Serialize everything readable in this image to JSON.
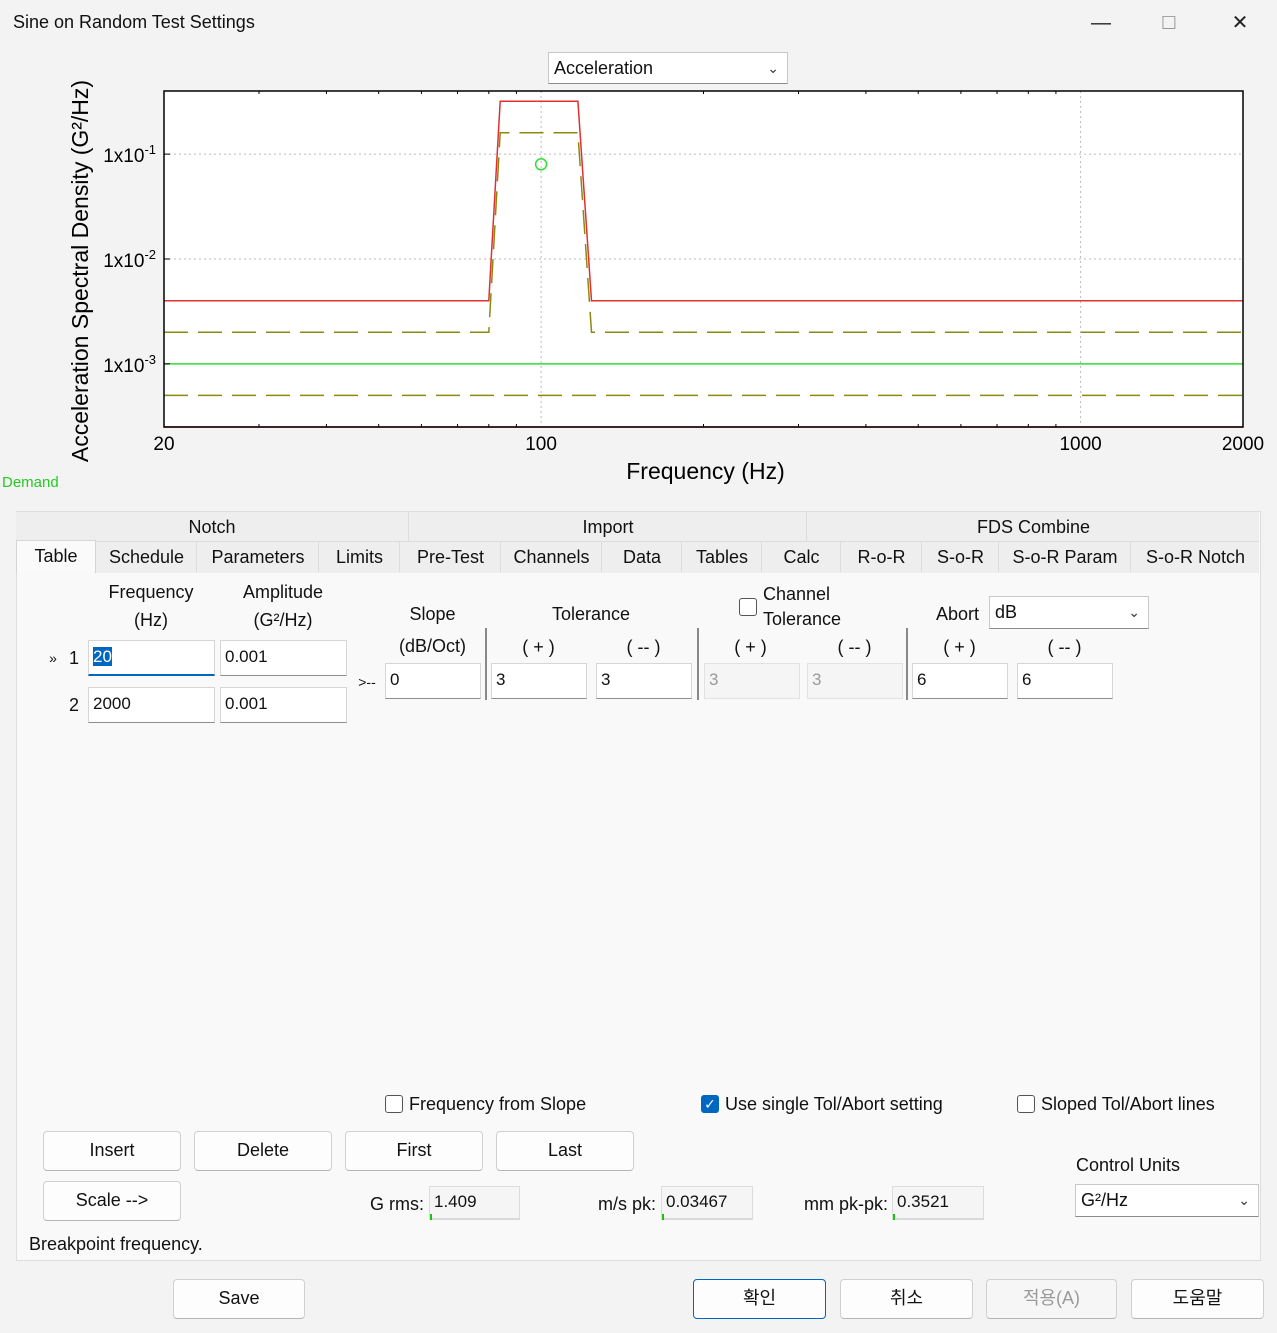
{
  "window": {
    "title": "Sine on Random Test Settings",
    "minimize_glyph": "—",
    "maximize_glyph": "☐",
    "close_glyph": "✕"
  },
  "top_combo": {
    "value": "Acceleration"
  },
  "chart_data": {
    "type": "line",
    "xscale": "log",
    "yscale": "log",
    "xlabel": "Frequency (Hz)",
    "ylabel": "Acceleration Spectral Density (G²/Hz)",
    "xlim": [
      20,
      2000
    ],
    "ylim": [
      0.00025,
      0.4
    ],
    "xticks": [
      {
        "value": 20,
        "label": "20"
      },
      {
        "value": 100,
        "label": "100"
      },
      {
        "value": 1000,
        "label": "1000"
      },
      {
        "value": 2000,
        "label": "2000"
      }
    ],
    "yticks": [
      {
        "value": 0.1,
        "base": "1x10",
        "exp": "-1"
      },
      {
        "value": 0.01,
        "base": "1x10",
        "exp": "-2"
      },
      {
        "value": 0.001,
        "base": "1x10",
        "exp": "-3"
      }
    ],
    "grid": true,
    "series": [
      {
        "role": "demand",
        "color": "#33dd33",
        "style": "solid",
        "x": [
          20,
          2000
        ],
        "y": [
          0.001,
          0.001
        ]
      },
      {
        "role": "abort-upper",
        "color": "#e03030",
        "style": "solid",
        "x": [
          20,
          80,
          84,
          117,
          124,
          2000
        ],
        "y": [
          0.004,
          0.004,
          0.32,
          0.32,
          0.004,
          0.004
        ]
      },
      {
        "role": "abort-lower",
        "color": "#e03030",
        "style": "solid",
        "x": [
          20,
          2000
        ],
        "y": [
          0.00025,
          0.00025
        ]
      },
      {
        "role": "tolerance-upper",
        "color": "#8a8a10",
        "style": "dashed",
        "x": [
          20,
          80,
          84,
          117,
          124,
          2000
        ],
        "y": [
          0.002,
          0.002,
          0.16,
          0.16,
          0.002,
          0.002
        ]
      },
      {
        "role": "tolerance-lower",
        "color": "#8a8a10",
        "style": "dashed",
        "x": [
          20,
          2000
        ],
        "y": [
          0.0005,
          0.0005
        ]
      }
    ],
    "markers": [
      {
        "x": 100,
        "y": 0.08,
        "color": "#33dd33",
        "shape": "circle"
      }
    ]
  },
  "legend_demand": "Demand",
  "group_tabs": [
    "Notch",
    "Import",
    "FDS Combine"
  ],
  "tabs": [
    "Table",
    "Schedule",
    "Parameters",
    "Limits",
    "Pre-Test",
    "Channels",
    "Data",
    "Tables",
    "Calc",
    "R-o-R",
    "S-o-R",
    "S-o-R Param",
    "S-o-R Notch"
  ],
  "active_tab": "Table",
  "table": {
    "freq_header": [
      "Frequency",
      "(Hz)"
    ],
    "amp_header": [
      "Amplitude",
      "(G²/Hz)"
    ],
    "current_marker": "»",
    "rows": [
      {
        "num": "1",
        "frequency": "20",
        "amplitude": "0.001"
      },
      {
        "num": "2",
        "frequency": "2000",
        "amplitude": "0.001"
      }
    ],
    "segment_marker": ">--"
  },
  "segment": {
    "slope_header": [
      "Slope",
      "(dB/Oct)"
    ],
    "tolerance_header": "Tolerance",
    "channel_tolerance_label": [
      "Channel",
      "Tolerance"
    ],
    "channel_tolerance_checked": false,
    "abort_label": "Abort",
    "abort_unit": "dB",
    "plus_label": "( + )",
    "minus_label": "( -- )",
    "slope": "0",
    "tol_plus": "3",
    "tol_minus": "3",
    "ch_tol_plus": "3",
    "ch_tol_minus": "3",
    "abort_plus": "6",
    "abort_minus": "6"
  },
  "options": {
    "frequency_from_slope": {
      "label": "Frequency from Slope",
      "checked": false
    },
    "single_tol_abort": {
      "label": "Use single Tol/Abort setting",
      "checked": true
    },
    "sloped_lines": {
      "label": "Sloped Tol/Abort lines",
      "checked": false
    }
  },
  "buttons": {
    "insert": "Insert",
    "delete": "Delete",
    "first": "First",
    "last": "Last",
    "scale": "Scale -->"
  },
  "readouts": {
    "grms_label": "G rms:",
    "grms": "1.409",
    "mspk_label": "m/s pk:",
    "mspk": "0.03467",
    "mmpkpk_label": "mm pk-pk:",
    "mmpkpk": "0.3521"
  },
  "control_units": {
    "label": "Control Units",
    "value": "G²/Hz"
  },
  "status_text": "Breakpoint frequency.",
  "footer": {
    "save": "Save",
    "ok": "확인",
    "cancel": "취소",
    "apply": "적용(A)",
    "help": "도움말"
  }
}
